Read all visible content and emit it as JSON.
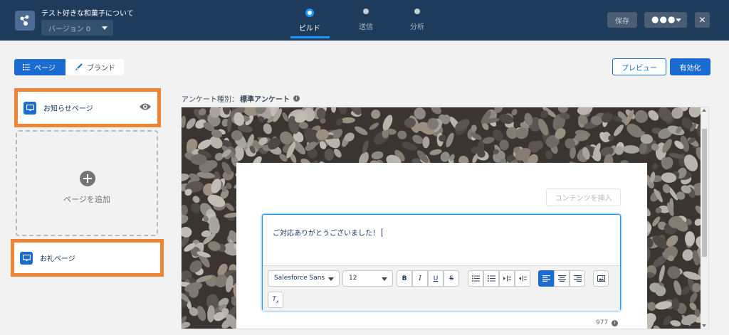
{
  "header": {
    "title": "テスト好きな和菓子について",
    "version_label": "バージョン 0",
    "steps": [
      {
        "label": "ビルド",
        "active": true
      },
      {
        "label": "送信",
        "active": false
      },
      {
        "label": "分析",
        "active": false
      }
    ],
    "save_label": "保存",
    "more_label": "●●●",
    "close_label": "✕"
  },
  "builder": {
    "tab_page": "ページ",
    "tab_brand": "ブランド",
    "preview_label": "プレビュー",
    "activate_label": "有効化"
  },
  "pages": [
    {
      "label": "お知らせページ",
      "icon": "monitor-icon",
      "visibility_icon": "eye-icon"
    },
    {
      "label": "お礼ページ",
      "icon": "monitor-icon"
    }
  ],
  "add_page_label": "ページを追加",
  "survey_type": {
    "prefix": "アンケート種別：",
    "value": "標準アンケート"
  },
  "editor": {
    "insert_label": "コンテンツを挿入",
    "text": "ご対応ありがとうございました！",
    "font": "Salesforce Sans",
    "size": "12",
    "char_count": "977"
  },
  "colors": {
    "header": "#1f3b5b",
    "accent": "#1b6cd0",
    "highlight": "#ee8536"
  }
}
